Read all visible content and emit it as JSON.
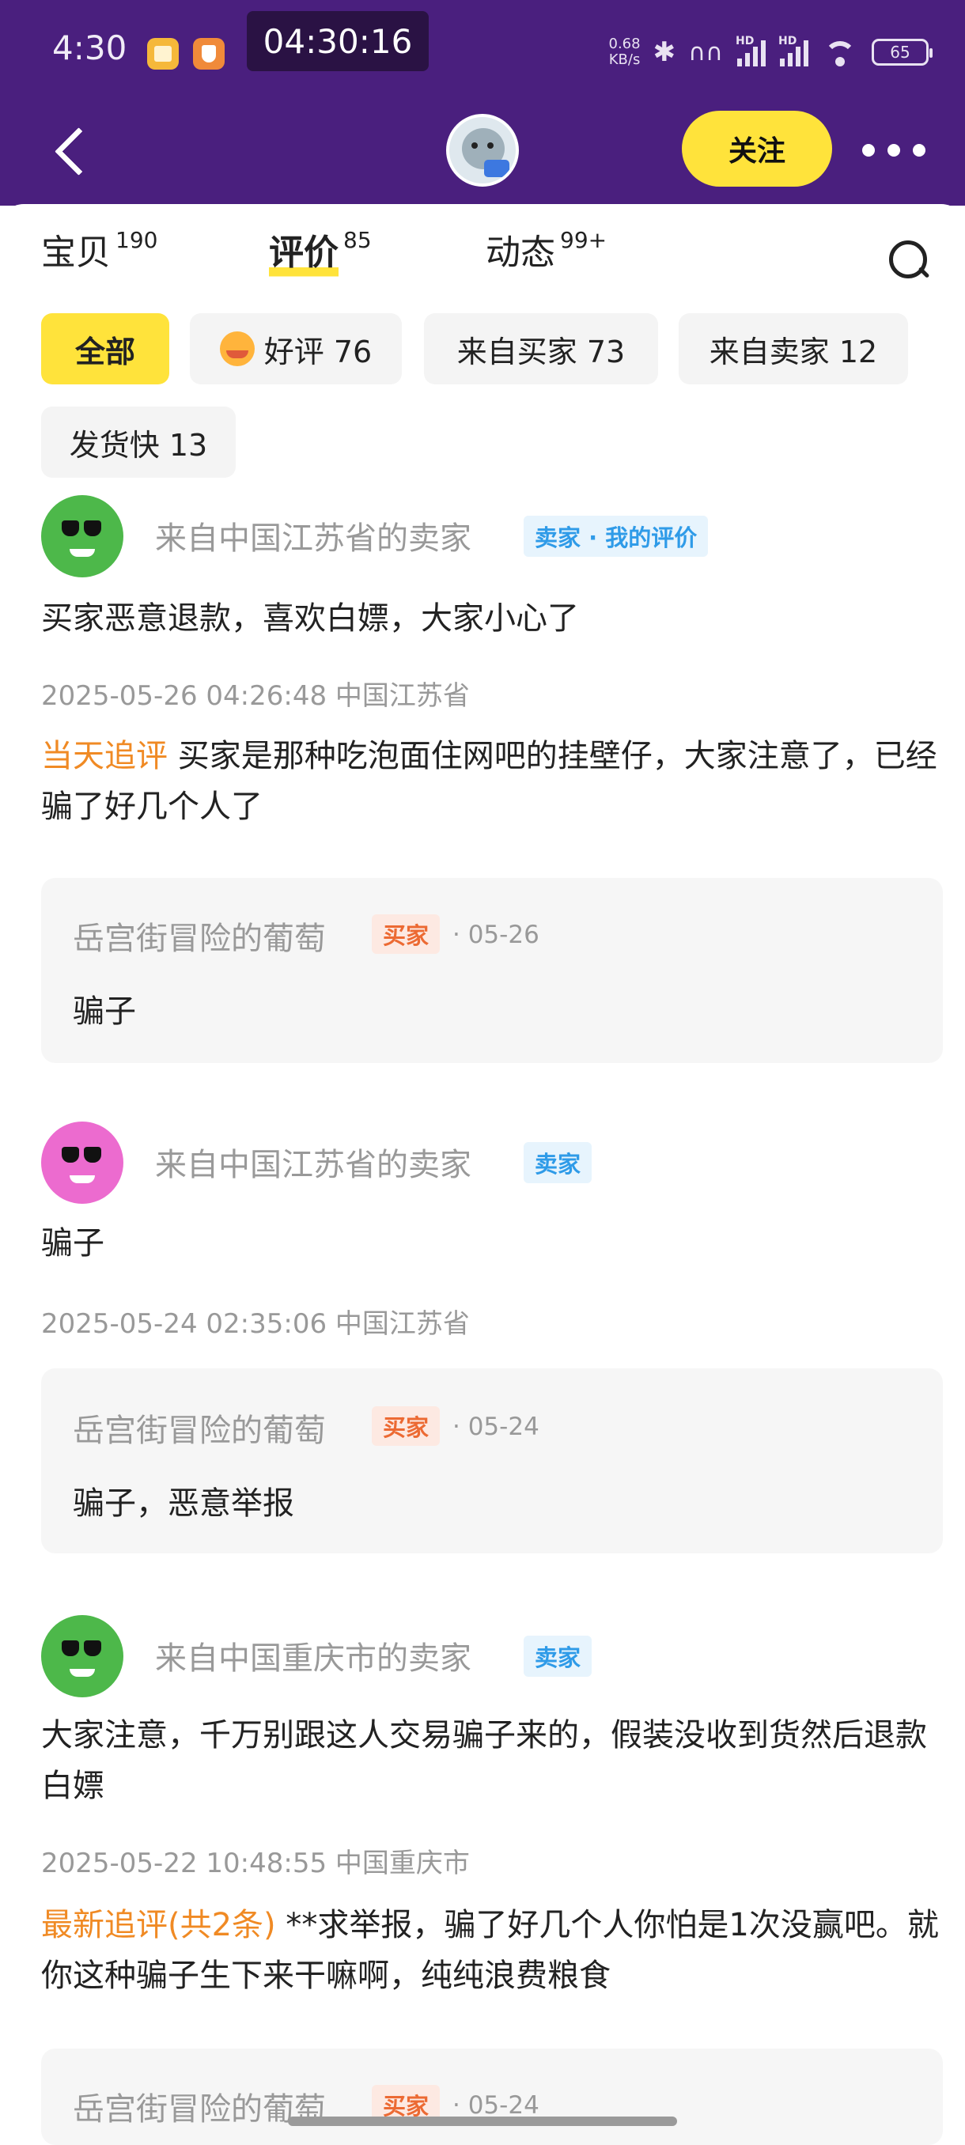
{
  "status_bar": {
    "time": "4:30",
    "recording_timer": "04:30:16",
    "net_speed_value": "0.68",
    "net_speed_unit": "KB/s",
    "sim1_label": "HD",
    "sim2_label": "HD",
    "battery": "65"
  },
  "header": {
    "follow_label": "关注"
  },
  "tabs": [
    {
      "label": "宝贝",
      "count": "190"
    },
    {
      "label": "评价",
      "count": "85"
    },
    {
      "label": "动态",
      "count": "99+"
    }
  ],
  "filters": [
    {
      "label": "全部"
    },
    {
      "label": "好评 76"
    },
    {
      "label": "来自买家 73"
    },
    {
      "label": "来自卖家 12"
    },
    {
      "label": "发货快 13"
    }
  ],
  "reviews": [
    {
      "reviewer": "来自中国江苏省的卖家",
      "badge": "卖家 · 我的评价",
      "text": "买家恶意退款，喜欢白嫖，大家小心了",
      "meta": "2025-05-26 04:26:48  中国江苏省",
      "followup_label": "当天追评",
      "followup_text": " 买家是那种吃泡面住网吧的挂壁仔，大家注意了，已经骗了好几个人了",
      "reply": {
        "name": "岳宫街冒险的葡萄",
        "badge": "买家",
        "date": "· 05-26",
        "text": "骗子"
      }
    },
    {
      "reviewer": "来自中国江苏省的卖家",
      "badge": "卖家",
      "text": "骗子",
      "meta": "2025-05-24 02:35:06  中国江苏省",
      "reply": {
        "name": "岳宫街冒险的葡萄",
        "badge": "买家",
        "date": "· 05-24",
        "text": "骗子，恶意举报"
      }
    },
    {
      "reviewer": "来自中国重庆市的卖家",
      "badge": "卖家",
      "text": "大家注意，千万别跟这人交易骗子来的，假装没收到货然后退款白嫖",
      "meta": "2025-05-22 10:48:55  中国重庆市",
      "followup_label": "最新追评(共2条)",
      "followup_text": " **求举报，骗了好几个人你怕是1次没赢吧。就你这种骗子生下来干嘛啊，纯纯浪费粮食",
      "reply": {
        "name": "岳宫街冒险的葡萄",
        "badge": "买家",
        "date": "· 05-24",
        "text": ""
      }
    }
  ]
}
